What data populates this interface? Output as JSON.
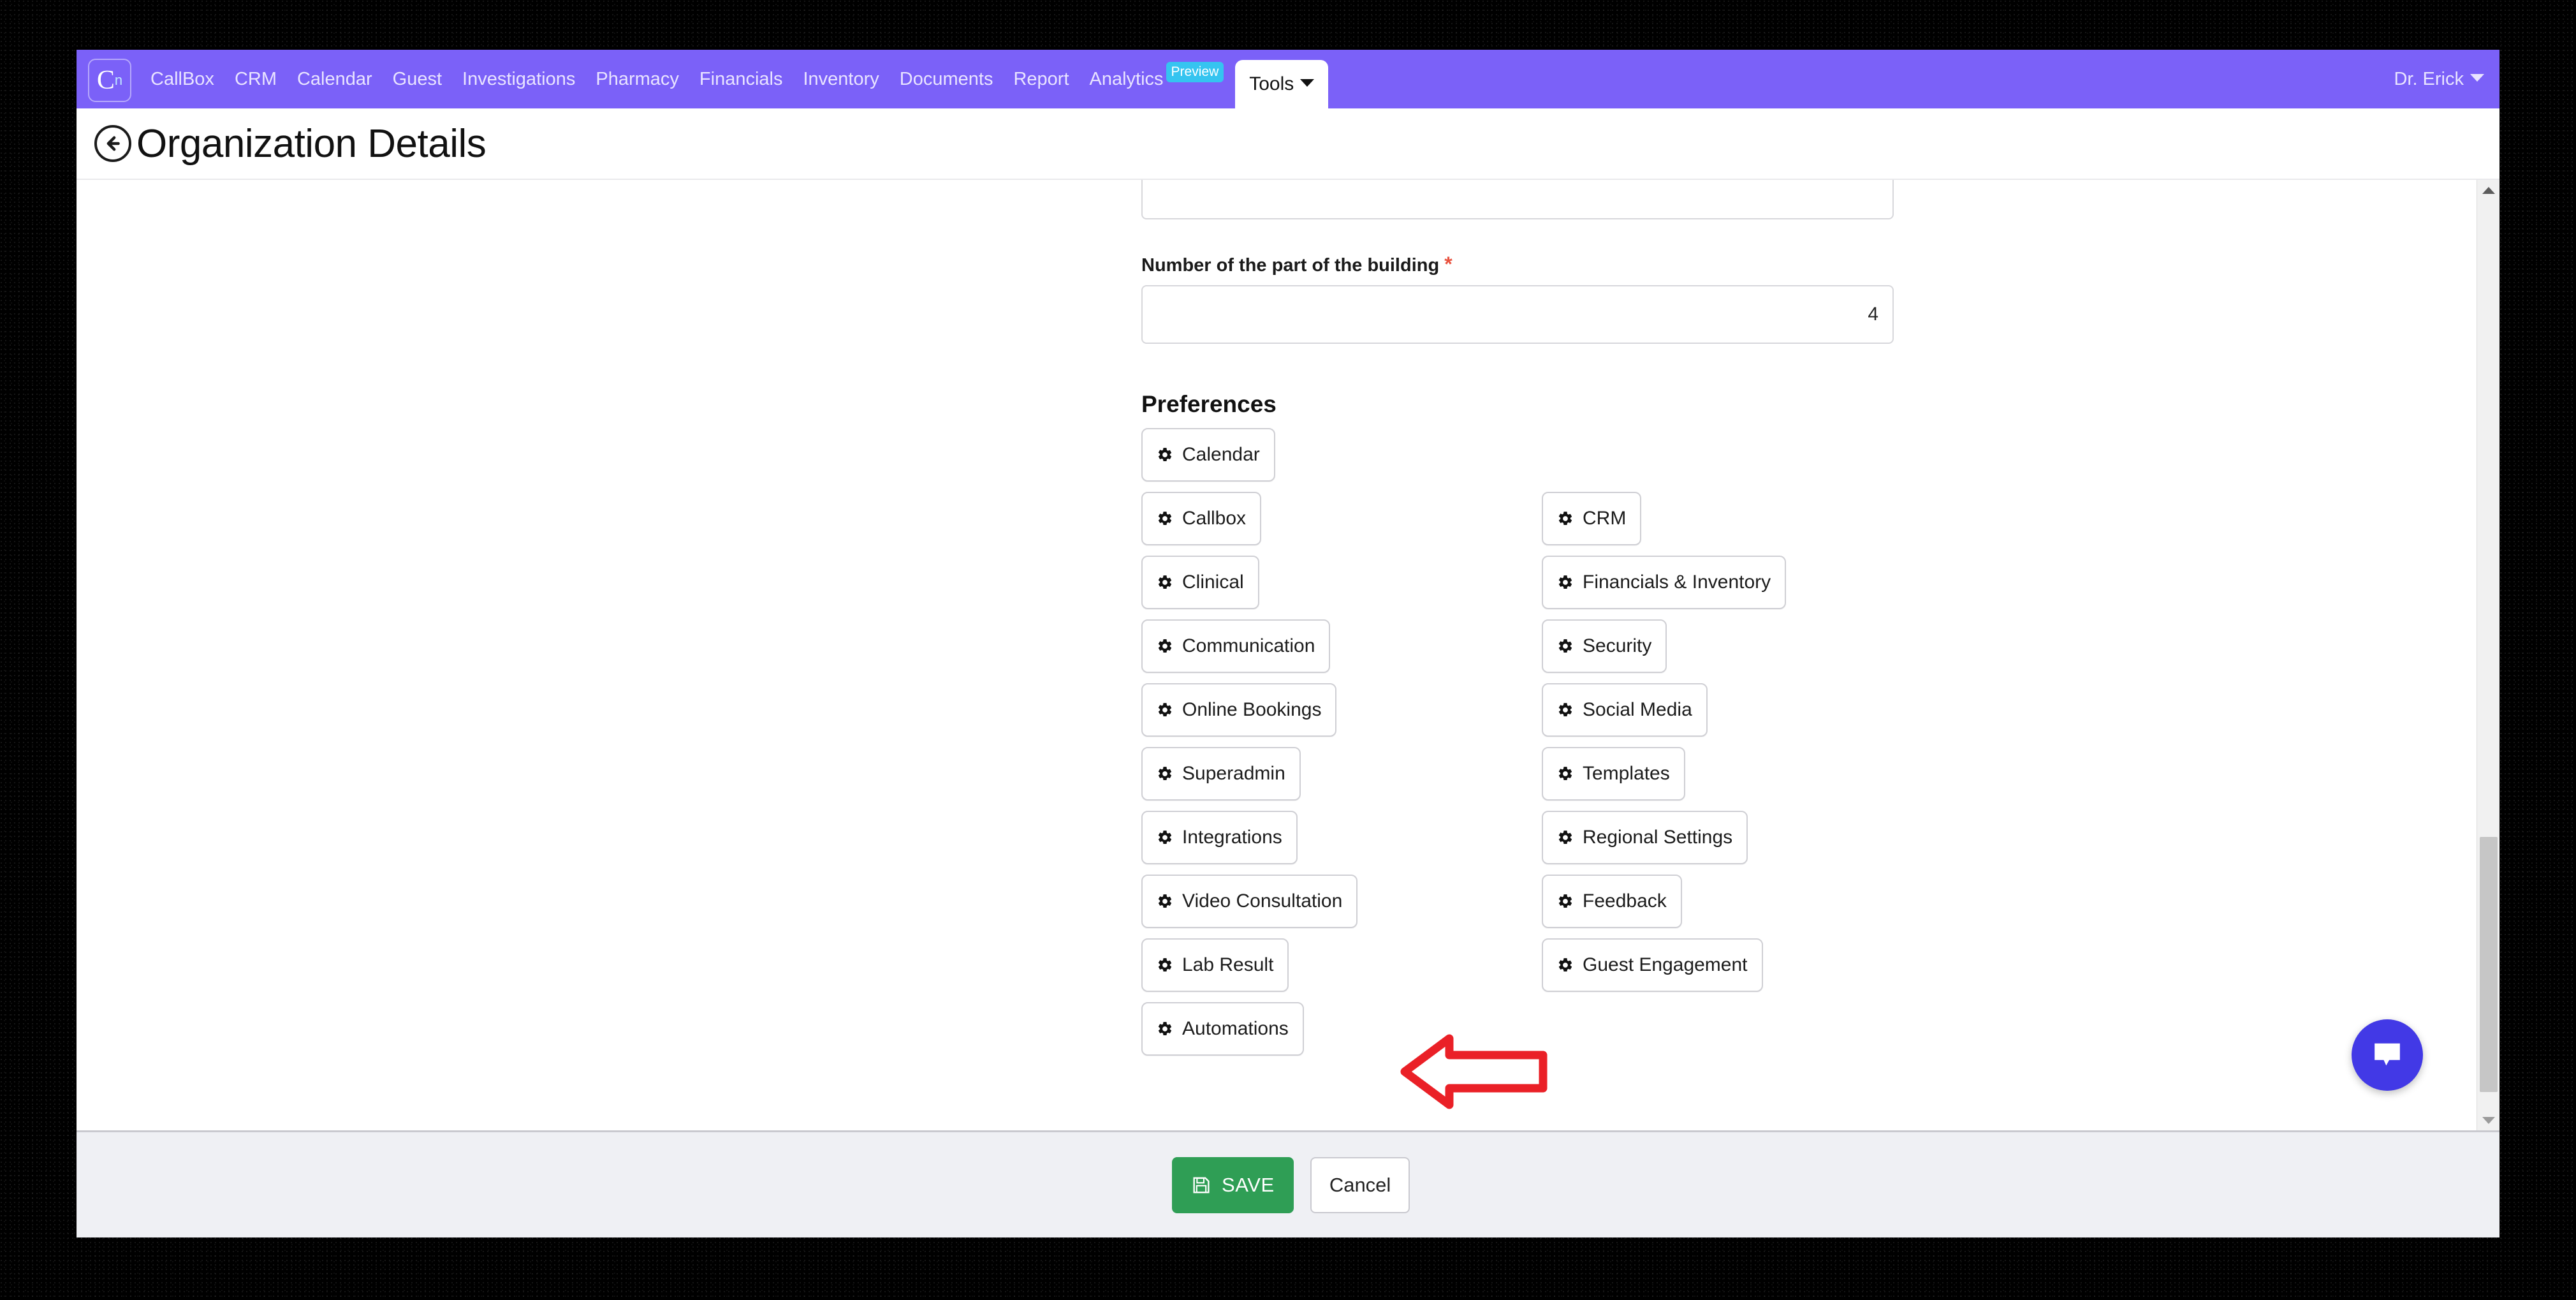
{
  "navbar": {
    "logo": {
      "letter": "C",
      "superscript": "n",
      "icon": "brand-logo-icon"
    },
    "links": [
      {
        "label": "CallBox"
      },
      {
        "label": "CRM"
      },
      {
        "label": "Calendar"
      },
      {
        "label": "Guest"
      },
      {
        "label": "Investigations"
      },
      {
        "label": "Pharmacy"
      },
      {
        "label": "Financials"
      },
      {
        "label": "Inventory"
      },
      {
        "label": "Documents"
      },
      {
        "label": "Report"
      },
      {
        "label": "Analytics",
        "badge": "Preview"
      }
    ],
    "active_tab": "Tools",
    "user": "Dr. Erick",
    "bg_color": "#7b61f8",
    "badge_color": "#35c4f0"
  },
  "header": {
    "back_icon": "back-arrow-icon",
    "title": "Organization Details"
  },
  "form": {
    "field_above_label": "",
    "field_above_value": "",
    "building_part": {
      "label": "Number of the part of the building",
      "required_marker": "*",
      "value": "4",
      "placeholder": ""
    }
  },
  "preferences": {
    "heading": "Preferences",
    "icon": "gear-icon",
    "rows": [
      {
        "left": "Calendar",
        "right": null
      },
      {
        "left": "Callbox",
        "right": "CRM"
      },
      {
        "left": "Clinical",
        "right": "Financials & Inventory"
      },
      {
        "left": "Communication",
        "right": "Security"
      },
      {
        "left": "Online Bookings",
        "right": "Social Media"
      },
      {
        "left": "Superadmin",
        "right": "Templates"
      },
      {
        "left": "Integrations",
        "right": "Regional Settings"
      },
      {
        "left": "Video Consultation",
        "right": "Feedback"
      },
      {
        "left": "Lab Result",
        "right": "Guest Engagement"
      },
      {
        "left": "Automations",
        "right": null
      }
    ]
  },
  "annotation": {
    "type": "arrow",
    "direction": "left",
    "color": "#ea2027",
    "points_at": "Integrations"
  },
  "footer": {
    "save_label": "SAVE",
    "save_icon": "floppy-disk-icon",
    "save_color": "#2f9e55",
    "cancel_label": "Cancel"
  },
  "chat": {
    "icon": "chat-bubble-icon",
    "color": "#4239e6"
  },
  "scrollbar": {
    "up_icon": "caret-up-icon",
    "down_icon": "caret-down-icon"
  }
}
